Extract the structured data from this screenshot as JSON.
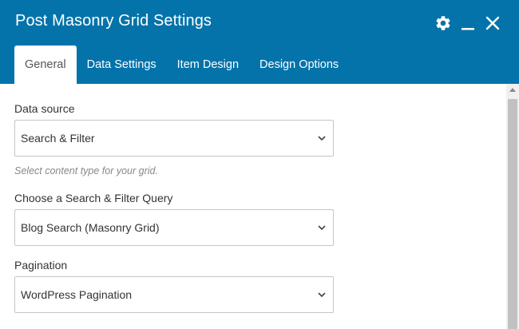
{
  "window": {
    "title": "Post Masonry Grid Settings",
    "controls": [
      "gear-icon",
      "minimize-icon",
      "close-icon"
    ]
  },
  "tabs": [
    {
      "label": "General",
      "active": true
    },
    {
      "label": "Data Settings",
      "active": false
    },
    {
      "label": "Item Design",
      "active": false
    },
    {
      "label": "Design Options",
      "active": false
    }
  ],
  "form": {
    "data_source": {
      "label": "Data source",
      "value": "Search & Filter",
      "hint": "Select content type for your grid."
    },
    "query": {
      "label": "Choose a Search & Filter Query",
      "value": "Blog Search (Masonry Grid)"
    },
    "pagination": {
      "label": "Pagination",
      "value": "WordPress Pagination"
    }
  },
  "colors": {
    "header": "#0473aa",
    "active_tab": "#ffffff",
    "border": "#c5c5c5"
  }
}
